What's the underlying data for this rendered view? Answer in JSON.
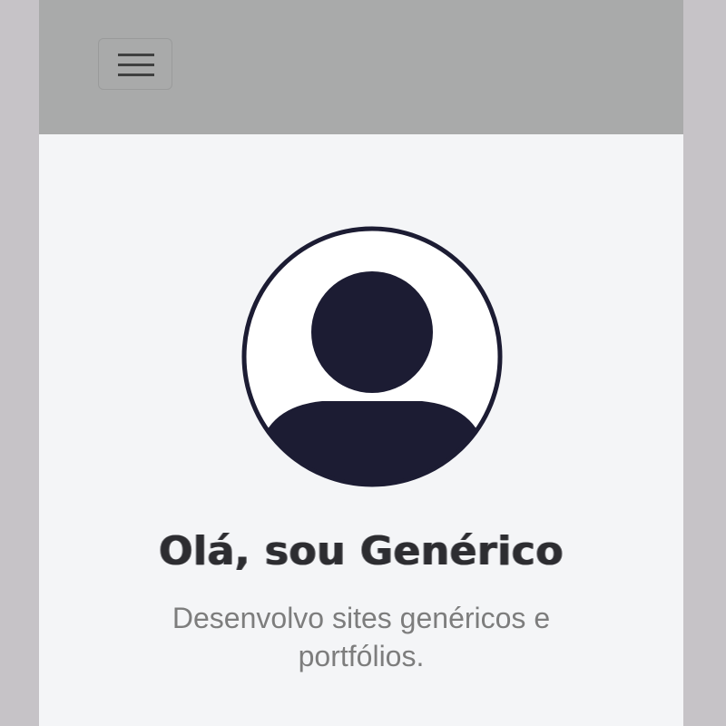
{
  "navbar": {
    "toggler_icon": "hamburger-menu-icon",
    "background": "#a9aaaa"
  },
  "hero": {
    "avatar_icon": "user-avatar-icon",
    "title": "Olá, sou Genérico",
    "subtitle": "Desenvolvo sites genéricos e portfólios."
  },
  "colors": {
    "accent": "#1c1c33",
    "page_background": "#f4f5f7",
    "subtitle_text": "#7d7d7d"
  }
}
